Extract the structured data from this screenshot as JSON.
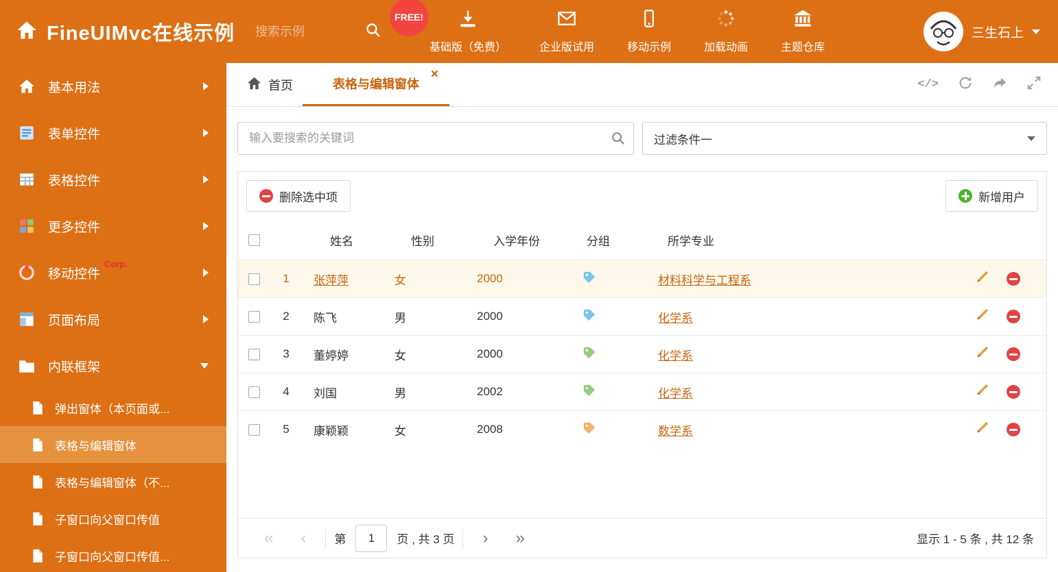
{
  "colors": {
    "primary_orange": "#dd6f14",
    "active_item_bg": "#e5913e",
    "link_orange": "#c8650f",
    "row_highlight_bg": "#fdf8ea",
    "free_badge_red": "#f34540",
    "delete_red": "#e04343",
    "add_green": "#4eb52c",
    "tag_blue": "#7ec3ea",
    "tag_green": "#97cc80",
    "tag_orange": "#f5b06a"
  },
  "header": {
    "title": "FineUIMvc在线示例",
    "search_placeholder": "搜索示例",
    "free_badge": "FREE!",
    "nav_items": [
      {
        "label": "基础版（免费）"
      },
      {
        "label": "企业版试用"
      },
      {
        "label": "移动示例"
      },
      {
        "label": "加载动画"
      },
      {
        "label": "主题仓库"
      }
    ],
    "username": "三生石上"
  },
  "sidebar": {
    "items": [
      {
        "label": "基本用法"
      },
      {
        "label": "表单控件"
      },
      {
        "label": "表格控件"
      },
      {
        "label": "更多控件"
      },
      {
        "label": "移动控件",
        "badge": "Corp."
      },
      {
        "label": "页面布局"
      },
      {
        "label": "内联框架"
      }
    ],
    "subitems": [
      {
        "label": "弹出窗体（本页面或..."
      },
      {
        "label": "表格与编辑窗体"
      },
      {
        "label": "表格与编辑窗体（不..."
      },
      {
        "label": "子窗口向父窗口传值"
      },
      {
        "label": "子窗口向父窗口传值..."
      }
    ]
  },
  "tabs": {
    "home_label": "首页",
    "active_label": "表格与编辑窗体",
    "close_icon": "×"
  },
  "topbar_icons": {
    "code": "</>"
  },
  "filters": {
    "search_placeholder": "输入要搜索的关键词",
    "filter_value": "过滤条件一"
  },
  "toolbar": {
    "delete_label": "删除选中项",
    "add_label": "新增用户"
  },
  "table": {
    "headers": {
      "name": "姓名",
      "gender": "性别",
      "year": "入学年份",
      "group": "分组",
      "major": "所学专业"
    },
    "rows": [
      {
        "num": "1",
        "name": "张萍萍",
        "gender": "女",
        "year": "2000",
        "tag_color": "blue",
        "major": "材料科学与工程系"
      },
      {
        "num": "2",
        "name": "陈飞",
        "gender": "男",
        "year": "2000",
        "tag_color": "blue",
        "major": "化学系"
      },
      {
        "num": "3",
        "name": "董婷婷",
        "gender": "女",
        "year": "2000",
        "tag_color": "green",
        "major": "化学系"
      },
      {
        "num": "4",
        "name": "刘国",
        "gender": "男",
        "year": "2002",
        "tag_color": "green",
        "major": "化学系"
      },
      {
        "num": "5",
        "name": "康颖颖",
        "gender": "女",
        "year": "2008",
        "tag_color": "orange",
        "major": "数学系"
      }
    ]
  },
  "pagination": {
    "icons": {
      "first": "«",
      "prev": "‹",
      "next": "›",
      "last": "»"
    },
    "page_prefix": "第",
    "current_page": "1",
    "page_suffix": "页 , 共 3 页",
    "summary": "显示 1 - 5 条 , 共 12 条"
  }
}
